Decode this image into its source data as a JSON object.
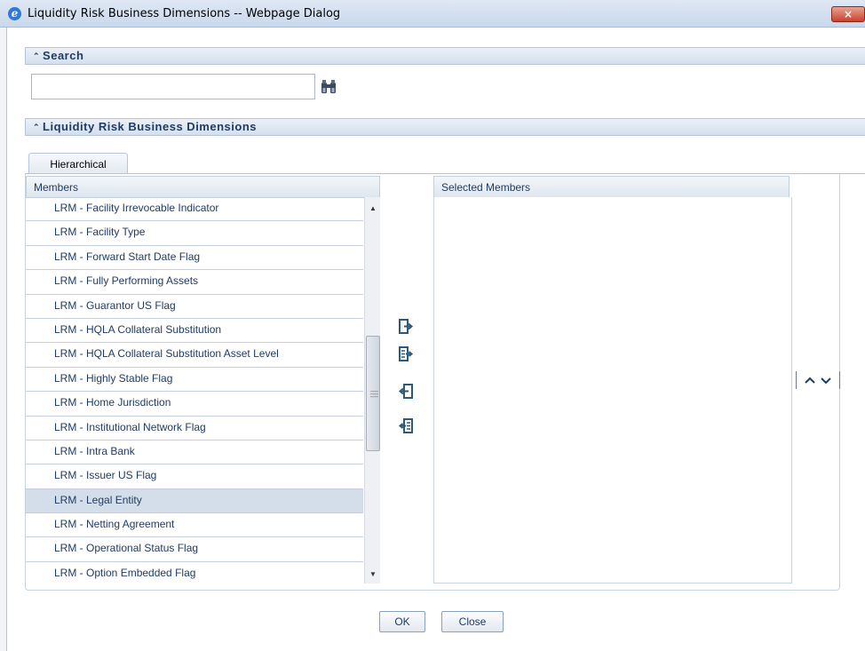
{
  "window": {
    "title": "Liquidity Risk Business Dimensions -- Webpage Dialog",
    "close_label": "×"
  },
  "search_section": {
    "title": "Search",
    "collapse_glyph": "⌃",
    "input_value": "",
    "search_icon": "binoculars-icon"
  },
  "dimensions_section": {
    "title": "Liquidity Risk Business Dimensions",
    "collapse_glyph": "⌃"
  },
  "tabs": [
    {
      "label": "Hierarchical",
      "active": true
    }
  ],
  "members": {
    "header": "Members",
    "items": [
      "LRM - Facility Irrevocable Indicator",
      "LRM - Facility Type",
      "LRM - Forward Start Date Flag",
      "LRM - Fully Performing Assets",
      "LRM - Guarantor US Flag",
      "LRM - HQLA Collateral Substitution",
      "LRM - HQLA Collateral Substitution Asset Level",
      "LRM - Highly Stable Flag",
      "LRM - Home Jurisdiction",
      "LRM - Institutional Network Flag",
      "LRM - Intra Bank",
      "LRM - Issuer US Flag",
      "LRM - Legal Entity",
      "LRM - Netting Agreement",
      "LRM - Operational Status Flag",
      "LRM - Option Embedded Flag"
    ],
    "selected_item": "LRM - Legal Entity"
  },
  "selected_members": {
    "header": "Selected Members",
    "items": []
  },
  "move_buttons": [
    "select-icon",
    "select-all-icon",
    "deselect-icon",
    "deselect-all-icon"
  ],
  "order_buttons": [
    "move-up-icon",
    "move-down-icon"
  ],
  "footer": {
    "ok_label": "OK",
    "close_label": "Close"
  },
  "colors": {
    "header_text": "#1f3c64",
    "selected_row": "#d3deea",
    "border": "#c3cedc"
  }
}
